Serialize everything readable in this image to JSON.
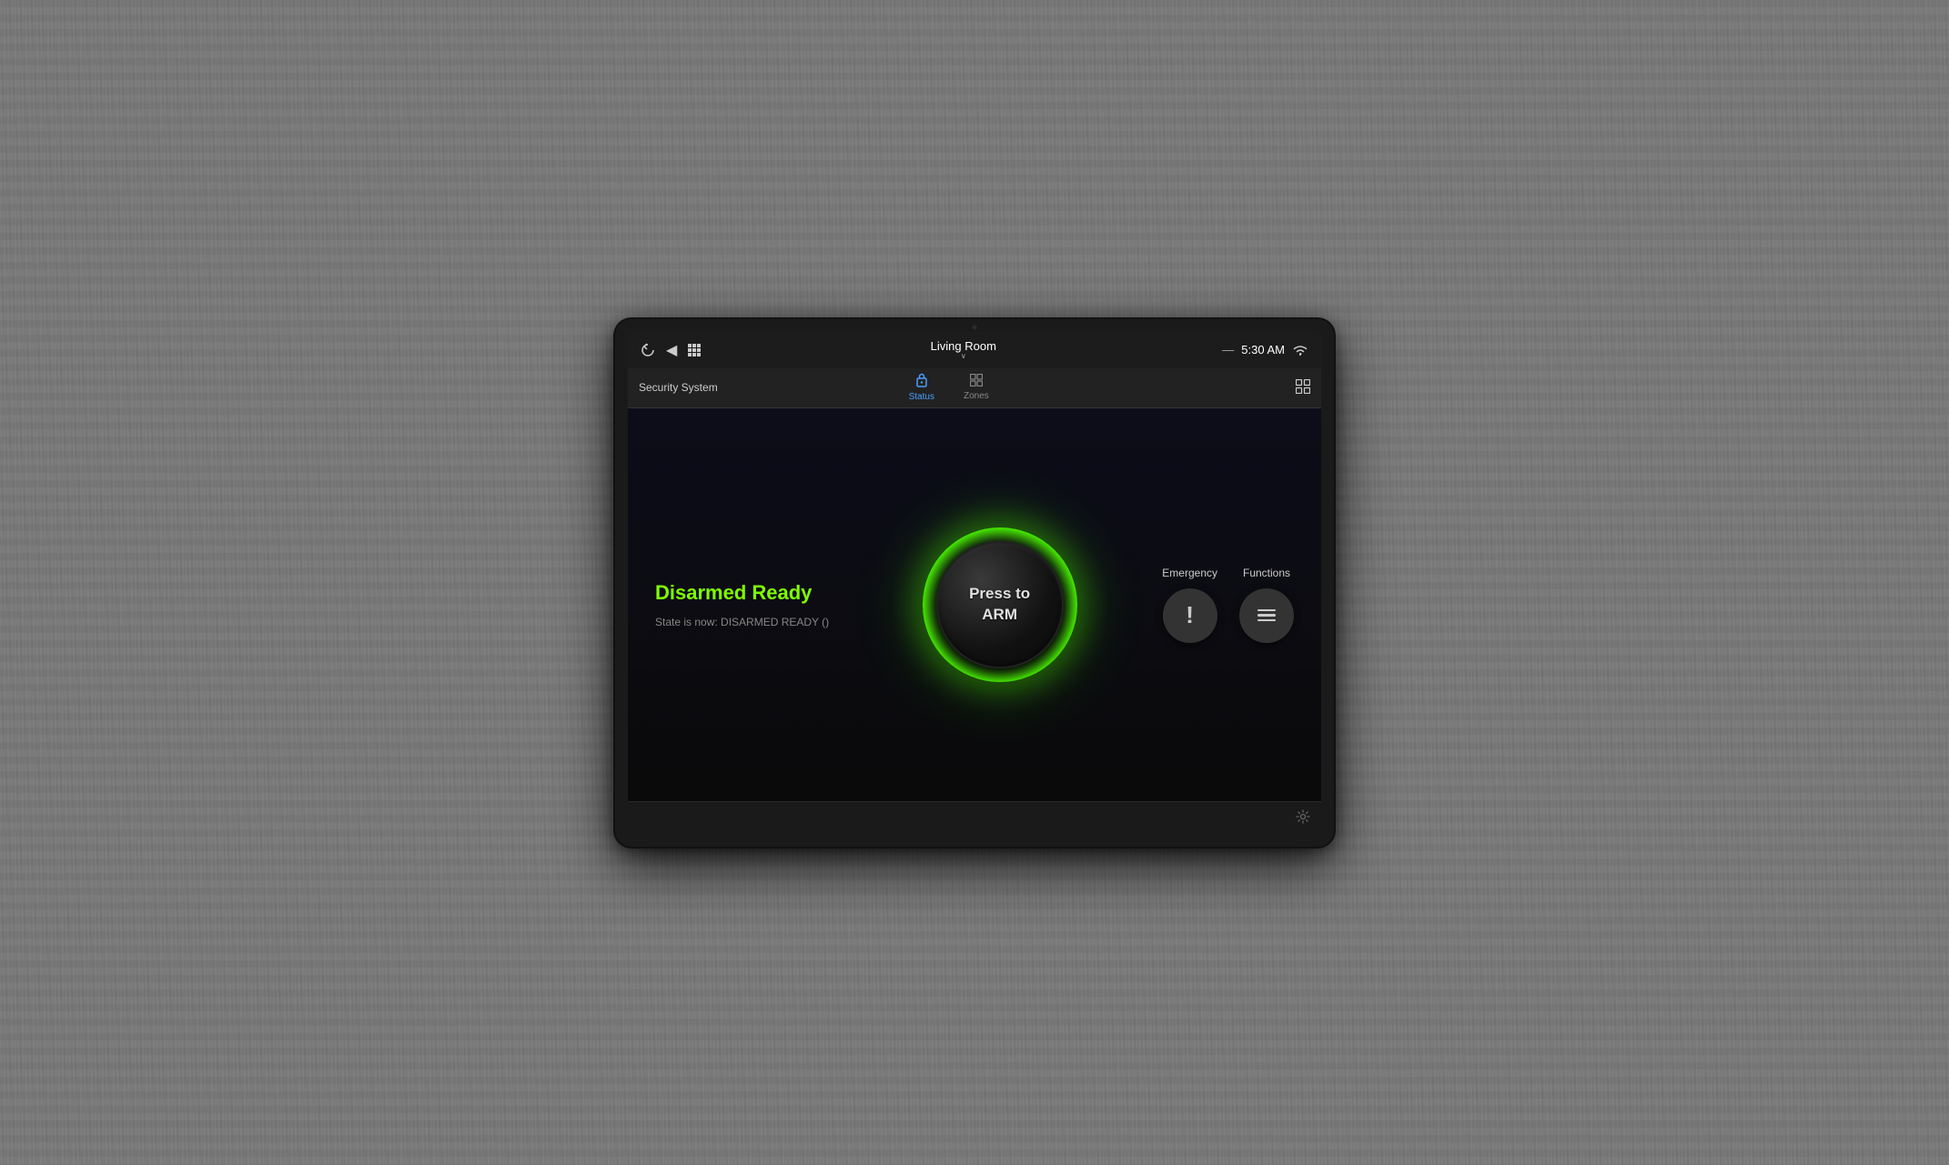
{
  "device": {
    "camera_dot": "camera"
  },
  "statusBar": {
    "back_icon": "◀",
    "menu_icon": "▦",
    "room_name": "Living Room",
    "room_arrow": "∨",
    "separator": "—",
    "time": "5:30 AM",
    "wifi_icon": "wifi"
  },
  "navBar": {
    "title": "Security System",
    "tabs": [
      {
        "id": "status",
        "label": "Status",
        "icon": "🔒",
        "active": true
      },
      {
        "id": "zones",
        "label": "Zones",
        "icon": "⊞",
        "active": false
      }
    ],
    "grid_icon": "⊞"
  },
  "mainContent": {
    "status_label": "Disarmed Ready",
    "state_text": "State is now: DISARMED READY ()",
    "arm_button": {
      "line1": "Press to",
      "line2": "ARM",
      "full_text": "Press to\nARM"
    },
    "actions": [
      {
        "id": "emergency",
        "label": "Emergency",
        "icon": "!"
      },
      {
        "id": "functions",
        "label": "Functions",
        "icon": "menu"
      }
    ]
  },
  "bottomBar": {
    "settings_icon": "settings"
  },
  "colors": {
    "active_tab": "#4a9eff",
    "status_green": "#7fff00",
    "arm_ring": "#4cff00",
    "background": "#0d0d1a"
  }
}
